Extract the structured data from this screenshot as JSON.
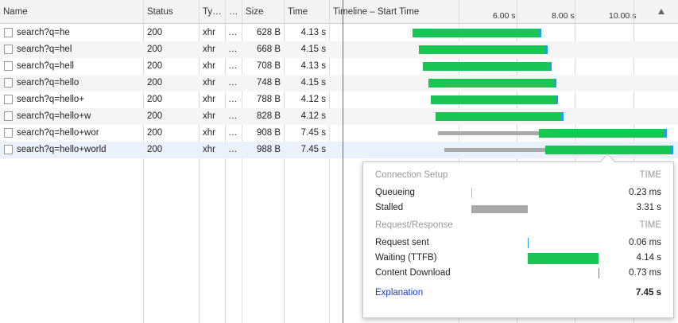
{
  "columns": {
    "name": "Name",
    "status": "Status",
    "type": "Ty…",
    "initiator": "…",
    "size": "Size",
    "time": "Time",
    "timeline": "Timeline – Start Time"
  },
  "timeline_ticks": [
    "6.00 s",
    "8.00 s",
    "10.00 s"
  ],
  "sort_icon": "triangle-up-icon",
  "requests": [
    {
      "name": "search?q=he",
      "status": "200",
      "type": "xhr",
      "initiator": "…",
      "size": "628 B",
      "time": "4.13 s"
    },
    {
      "name": "search?q=hel",
      "status": "200",
      "type": "xhr",
      "initiator": "…",
      "size": "668 B",
      "time": "4.15 s"
    },
    {
      "name": "search?q=hell",
      "status": "200",
      "type": "xhr",
      "initiator": "…",
      "size": "708 B",
      "time": "4.13 s"
    },
    {
      "name": "search?q=hello",
      "status": "200",
      "type": "xhr",
      "initiator": "…",
      "size": "748 B",
      "time": "4.15 s"
    },
    {
      "name": "search?q=hello+",
      "status": "200",
      "type": "xhr",
      "initiator": "…",
      "size": "788 B",
      "time": "4.12 s"
    },
    {
      "name": "search?q=hello+w",
      "status": "200",
      "type": "xhr",
      "initiator": "…",
      "size": "828 B",
      "time": "4.12 s"
    },
    {
      "name": "search?q=hello+wor",
      "status": "200",
      "type": "xhr",
      "initiator": "…",
      "size": "908 B",
      "time": "7.45 s"
    },
    {
      "name": "search?q=hello+world",
      "status": "200",
      "type": "xhr",
      "initiator": "…",
      "size": "988 B",
      "time": "7.45 s"
    }
  ],
  "timing_popup": {
    "connection_header": "Connection Setup",
    "time_header_1": "TIME",
    "queueing_label": "Queueing",
    "queueing_value": "0.23 ms",
    "stalled_label": "Stalled",
    "stalled_value": "3.31 s",
    "request_header": "Request/Response",
    "time_header_2": "TIME",
    "request_sent_label": "Request sent",
    "request_sent_value": "0.06 ms",
    "waiting_label": "Waiting (TTFB)",
    "waiting_value": "4.14 s",
    "download_label": "Content Download",
    "download_value": "0.73 ms",
    "explanation_label": "Explanation",
    "total_value": "7.45 s"
  },
  "colors": {
    "waiting": "#19c553",
    "download": "#1fa1e6",
    "stalled": "#a9a9a9",
    "load_line": "#b03a8f",
    "link": "#1a3bc8"
  }
}
